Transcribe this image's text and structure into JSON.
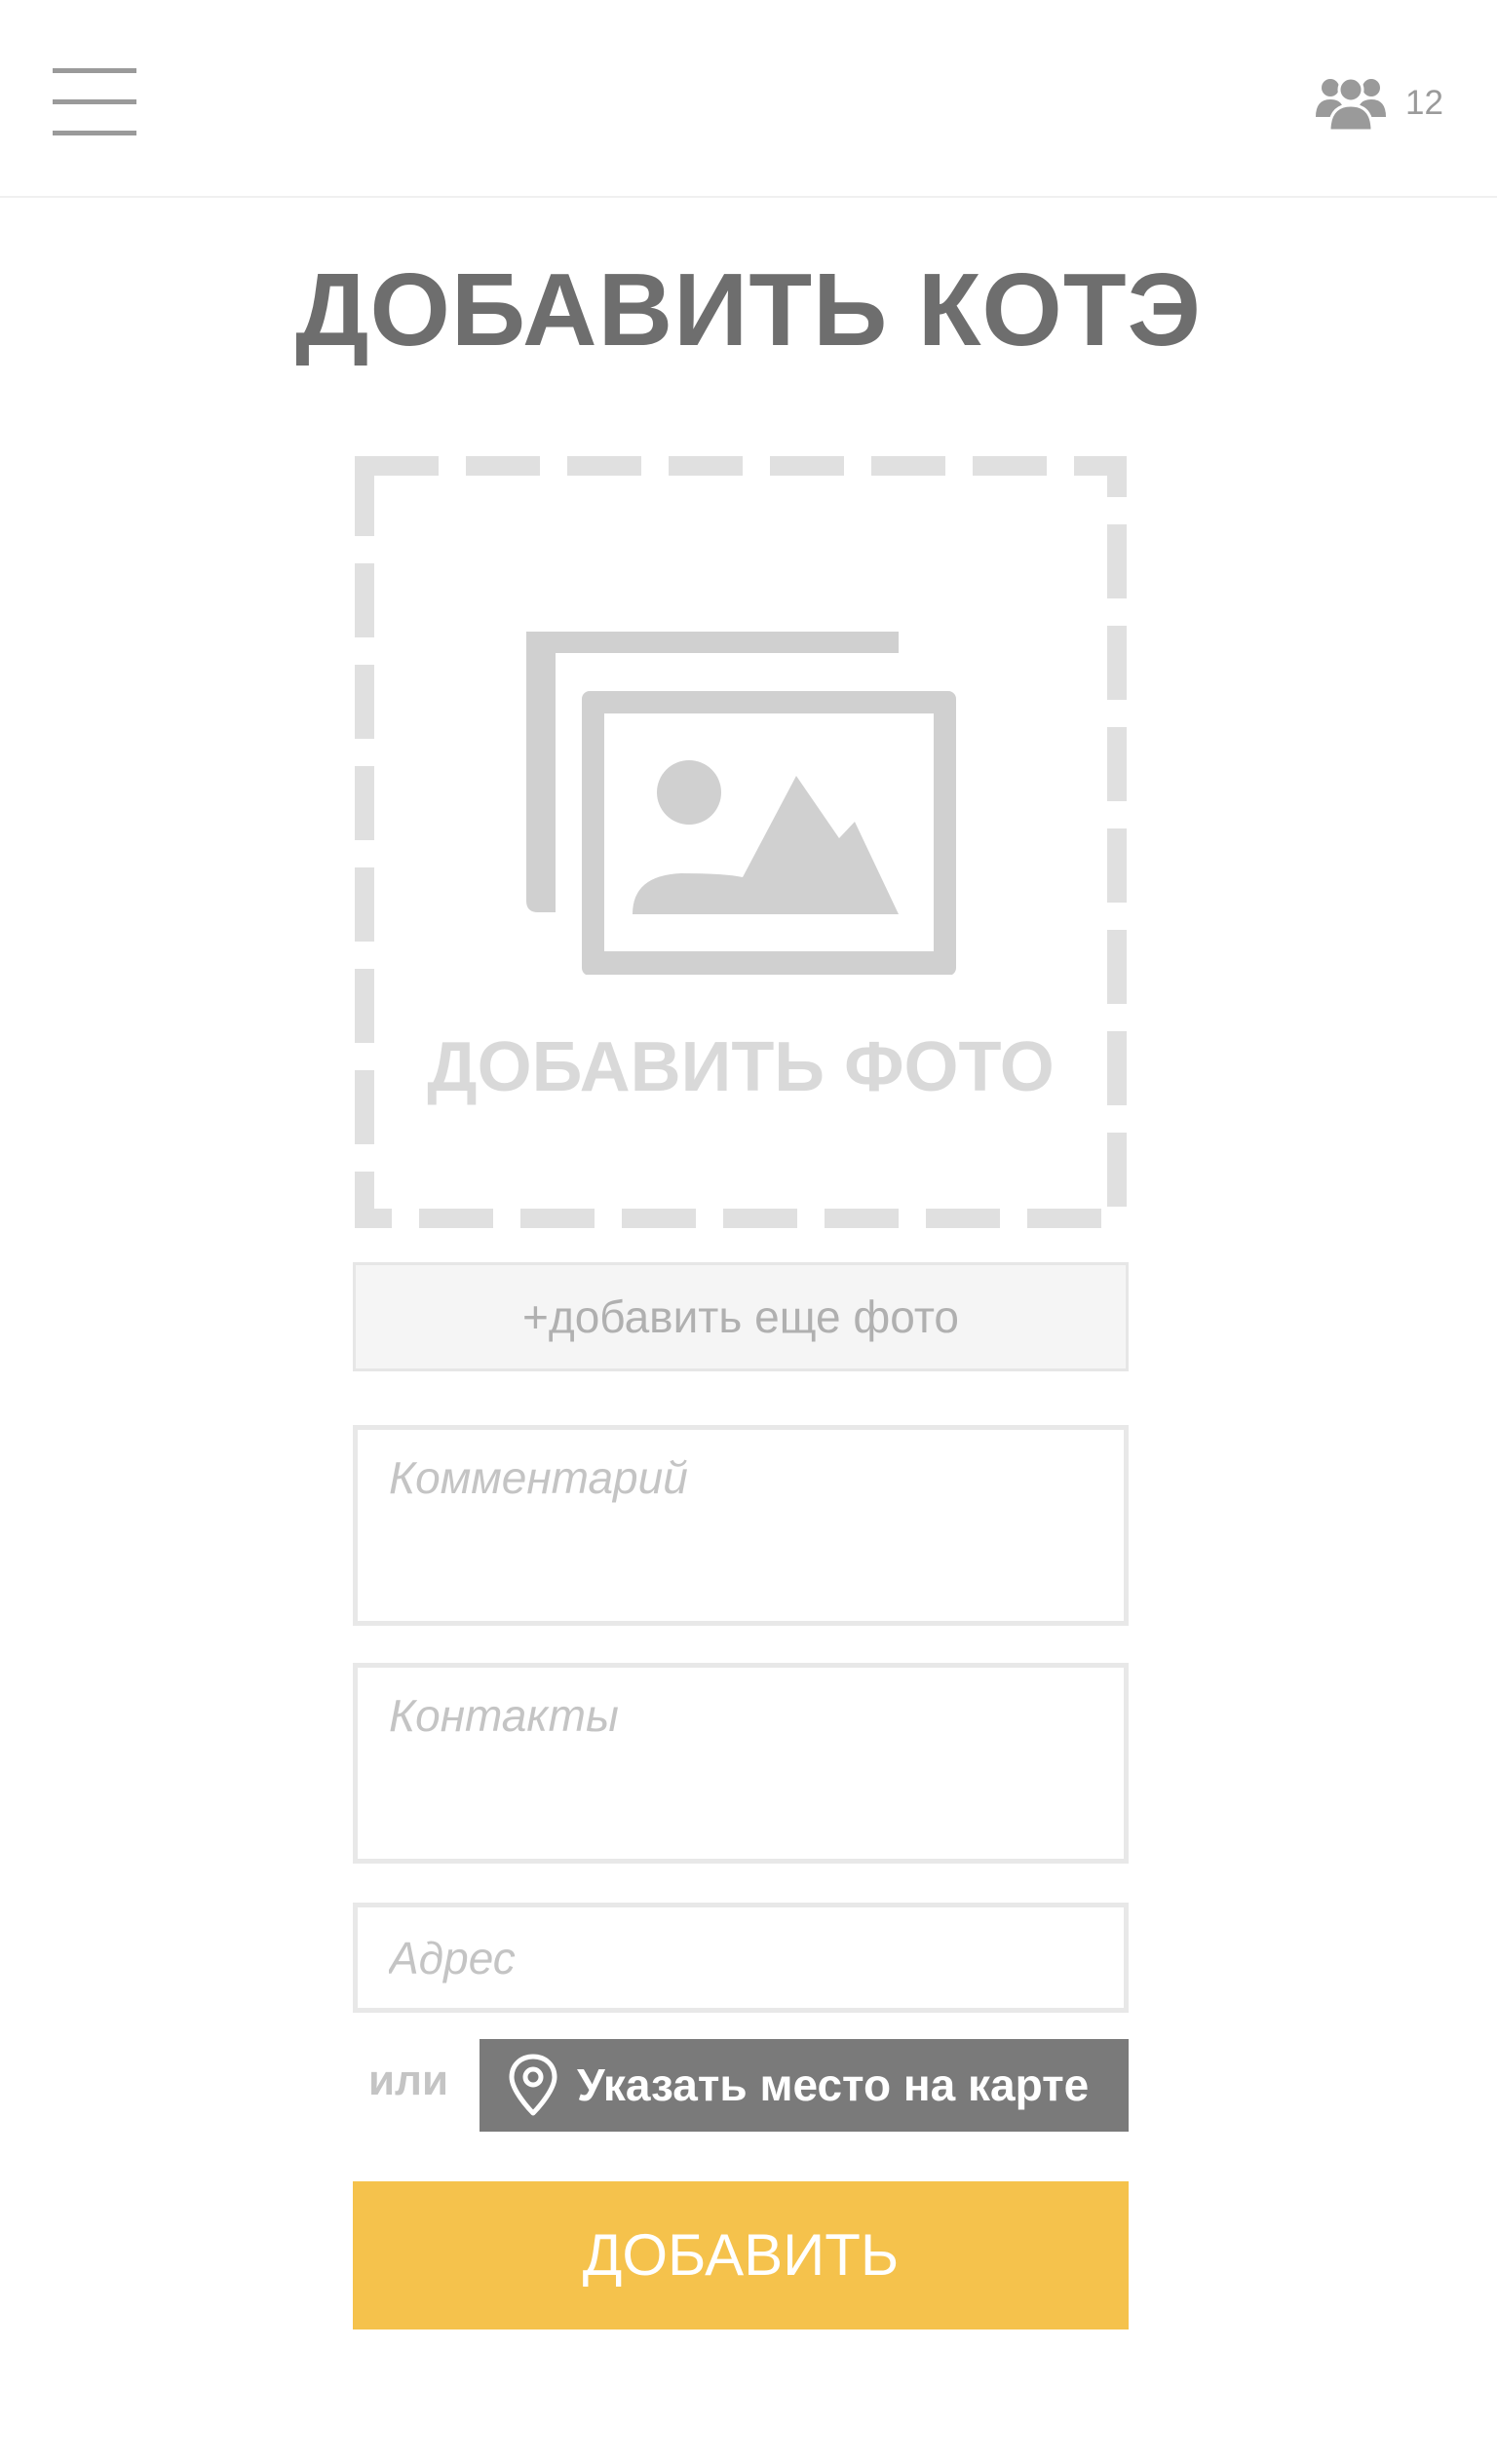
{
  "header": {
    "menu_icon": "hamburger-menu-icon",
    "users_icon": "users-group-icon",
    "users_count": "12"
  },
  "title": "ДОБАВИТЬ КОТЭ",
  "photo": {
    "icon": "photo-gallery-icon",
    "dropzone_label": "ДОБАВИТЬ ФОТО",
    "add_more_label": "+добавить еще фото"
  },
  "form": {
    "comment_placeholder": "Комментарий",
    "comment_value": "",
    "contacts_placeholder": "Контакты",
    "contacts_value": "",
    "address_placeholder": "Адрес",
    "address_value": "",
    "or_label": "или",
    "map_icon": "map-pin-icon",
    "map_button_label": "Указать место на карте",
    "submit_label": "ДОБАВИТЬ"
  },
  "colors": {
    "accent": "#f5c24c",
    "map_button": "#7a7a7a",
    "title_text": "#6e6e6e",
    "placeholder_text": "#c4c4c4",
    "dashed_border": "#e0e0e0"
  }
}
